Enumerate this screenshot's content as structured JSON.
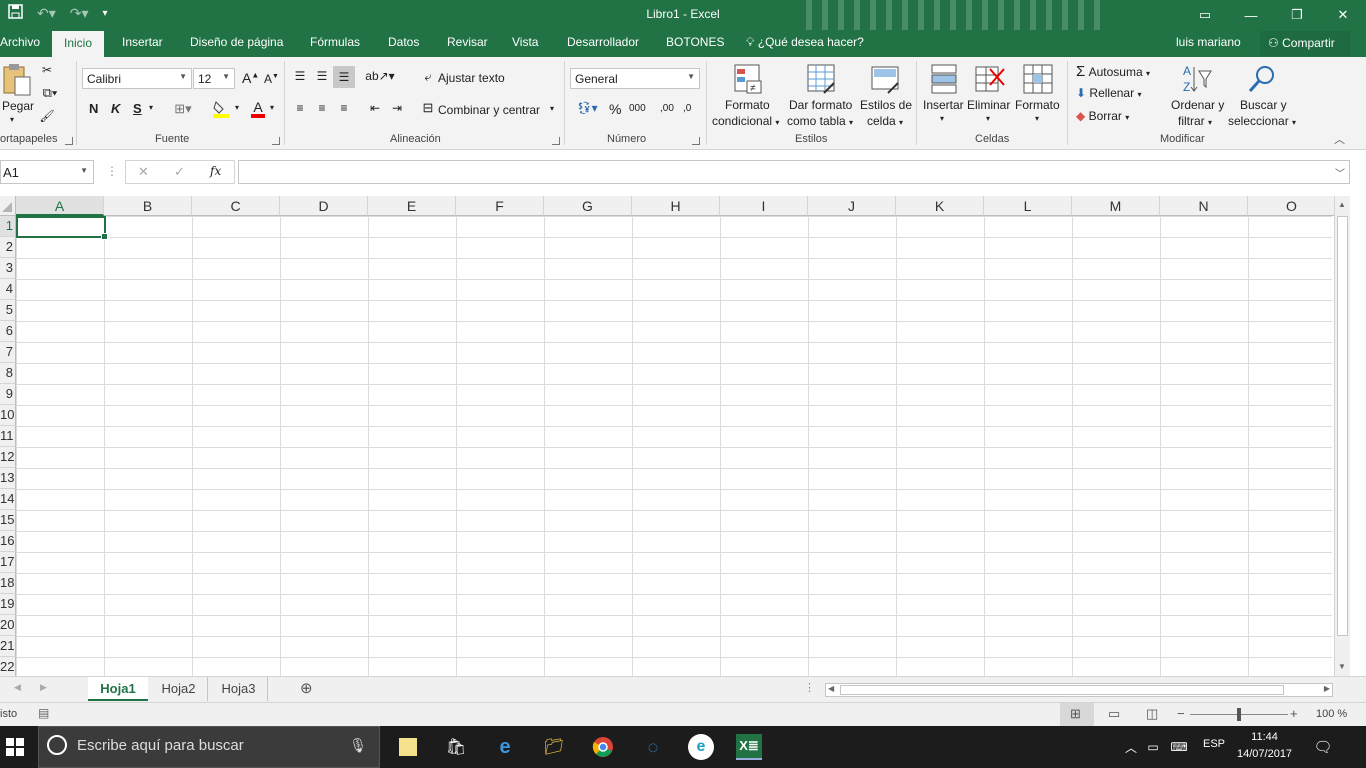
{
  "window": {
    "title": "Libro1 - Excel",
    "restore_icon": "restore-icon",
    "minimize_icon": "minimize-icon",
    "close_icon": "close-icon"
  },
  "tabs": [
    "Archivo",
    "Inicio",
    "Insertar",
    "Diseño de página",
    "Fórmulas",
    "Datos",
    "Revisar",
    "Vista",
    "Desarrollador",
    "BOTONES"
  ],
  "active_tab": "Inicio",
  "tell_me": "¿Qué desea hacer?",
  "user": "luis mariano",
  "share": "Compartir",
  "ribbon": {
    "clipboard": {
      "label": "ortapapeles",
      "paste": "Pegar"
    },
    "font": {
      "label": "Fuente",
      "name": "Calibri",
      "size": "12",
      "bold": "N",
      "italic": "K",
      "underline": "S",
      "grow": "A",
      "shrink": "A",
      "color_letter": "A"
    },
    "alignment": {
      "label": "Alineación",
      "wrap": "Ajustar texto",
      "merge": "Combinar y centrar"
    },
    "number": {
      "label": "Número",
      "format": "General",
      "percent": "%",
      "thousands": "000",
      "inc_decimal": ",00",
      "dec_decimal": ",0"
    },
    "styles": {
      "label": "Estilos",
      "conditional_1": "Formato",
      "conditional_2": "condicional",
      "table_1": "Dar formato",
      "table_2": "como tabla",
      "cell_1": "Estilos de",
      "cell_2": "celda"
    },
    "cells": {
      "label": "Celdas",
      "insert": "Insertar",
      "delete": "Eliminar",
      "format": "Formato"
    },
    "editing": {
      "label": "Modificar",
      "autosum": "Autosuma",
      "fill": "Rellenar",
      "clear": "Borrar",
      "sort_1": "Ordenar y",
      "sort_2": "filtrar",
      "find_1": "Buscar y",
      "find_2": "seleccionar"
    }
  },
  "formula_bar": {
    "name_box": "A1",
    "fx": "fx",
    "value": ""
  },
  "columns": [
    "A",
    "B",
    "C",
    "D",
    "E",
    "F",
    "G",
    "H",
    "I",
    "J",
    "K",
    "L",
    "M",
    "N",
    "O"
  ],
  "rows": [
    "1",
    "2",
    "3",
    "4",
    "5",
    "6",
    "7",
    "8",
    "9",
    "10",
    "11",
    "12",
    "13",
    "14",
    "15",
    "16",
    "17",
    "18",
    "19",
    "20",
    "21",
    "22"
  ],
  "active_cell": "A1",
  "sheets": [
    "Hoja1",
    "Hoja2",
    "Hoja3"
  ],
  "active_sheet": "Hoja1",
  "status": {
    "ready": "isto",
    "zoom": "100 %",
    "zoom_level": 0.5
  },
  "taskbar": {
    "search_placeholder": "Escribe aquí para buscar",
    "language": "ESP",
    "time": "11:44",
    "date": "14/07/2017"
  },
  "colors": {
    "excel_green": "#217346",
    "ribbon_bg": "#f3f3f3",
    "taskbar_bg": "#1c1c1c"
  }
}
